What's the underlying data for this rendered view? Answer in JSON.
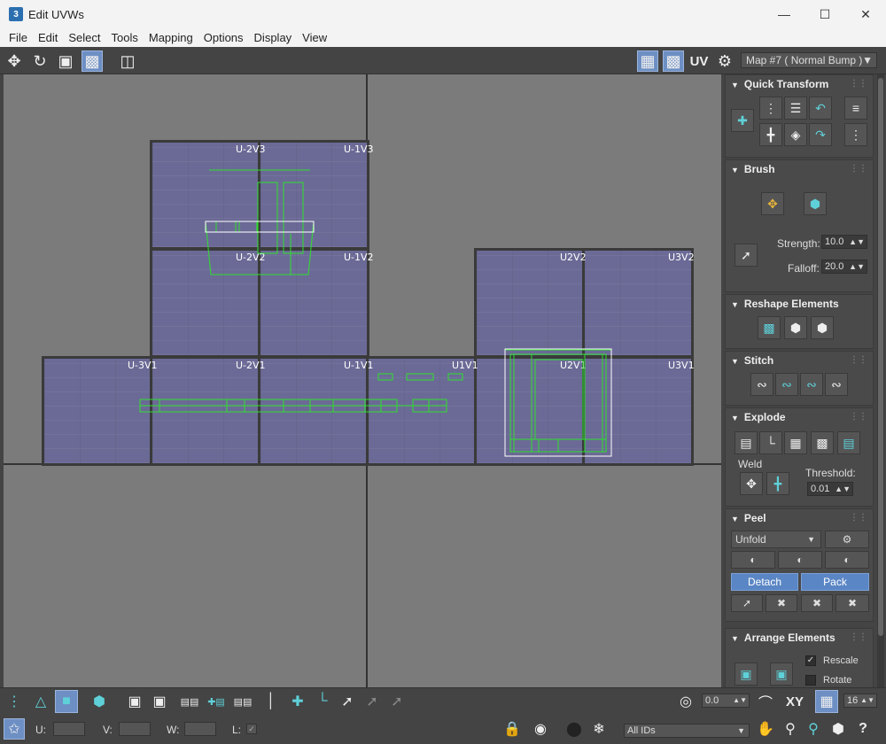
{
  "window": {
    "title": "Edit UVWs",
    "app_icon": "3"
  },
  "menu": [
    "File",
    "Edit",
    "Select",
    "Tools",
    "Mapping",
    "Options",
    "Display",
    "View"
  ],
  "toolbar": {
    "uv_label": "UV",
    "map_dropdown": "Map #7  ( Normal Bump )"
  },
  "viewport": {
    "tile_labels": [
      "U-2V3",
      "U-1V3",
      "U-2V2",
      "U-1V2",
      "U2V2",
      "U3V2",
      "U-3V1",
      "U-2V1",
      "U-1V1",
      "U1V1",
      "U2V1",
      "U3V1"
    ]
  },
  "rollouts": {
    "quick_transform": {
      "title": "Quick Transform"
    },
    "brush": {
      "title": "Brush",
      "strength_label": "Strength:",
      "strength": "10.0",
      "falloff_label": "Falloff:",
      "falloff": "20.0"
    },
    "reshape": {
      "title": "Reshape Elements"
    },
    "stitch": {
      "title": "Stitch"
    },
    "explode": {
      "title": "Explode",
      "weld_label": "Weld",
      "threshold_label": "Threshold:",
      "threshold": "0.01"
    },
    "peel": {
      "title": "Peel",
      "mode": "Unfold",
      "detach": "Detach",
      "pack": "Pack"
    },
    "arrange": {
      "title": "Arrange Elements",
      "rescale": "Rescale",
      "rotate": "Rotate"
    }
  },
  "bottom": {
    "u_label": "U:",
    "v_label": "V:",
    "w_label": "W:",
    "l_label": "L:",
    "angle_value": "0.0",
    "xy_label": "XY",
    "grid_value": "16",
    "ids_dropdown": "All IDs"
  }
}
